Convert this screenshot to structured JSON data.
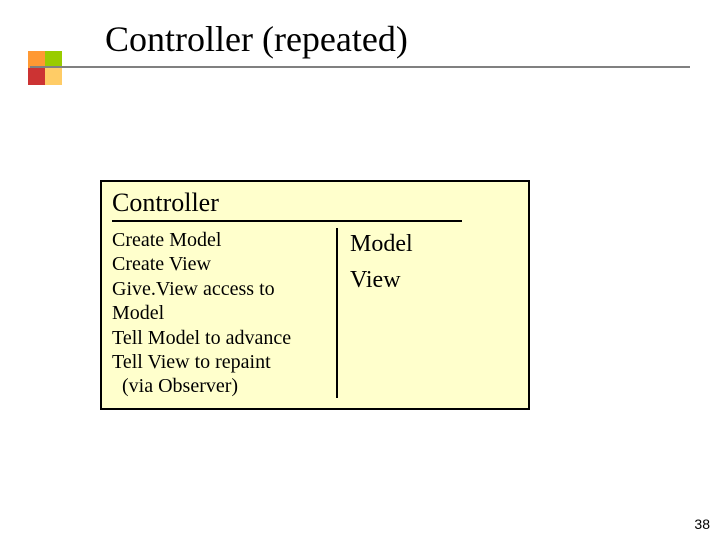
{
  "title": "Controller (repeated)",
  "box": {
    "header": "Controller",
    "left": {
      "l1": "Create Model",
      "l2": "Create View",
      "l3": "Give.View access to",
      "l4": "Model",
      "l5": "Tell Model to advance",
      "l6": "Tell View to repaint",
      "l7": "  (via Observer)"
    },
    "right": {
      "r1": "Model",
      "r2": "View"
    }
  },
  "page_number": "38"
}
